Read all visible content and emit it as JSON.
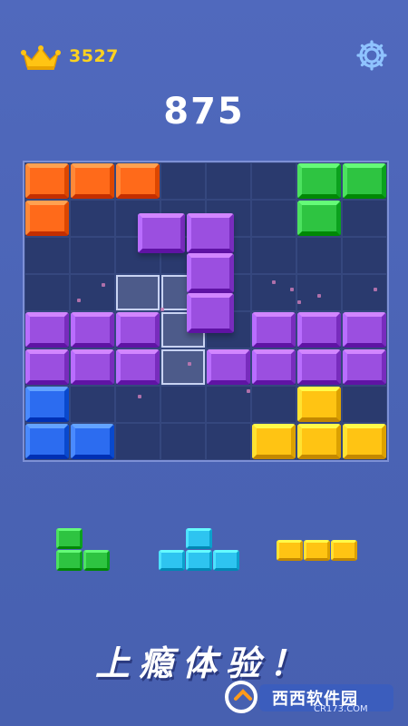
{
  "header": {
    "best_score": "3527",
    "current_score": "875",
    "crown_icon": "crown-icon",
    "settings_icon": "gear-icon"
  },
  "colors": {
    "orange": "#ff6a1a",
    "green": "#2ec441",
    "purple": "#9b4fe0",
    "blue": "#2c6cf0",
    "yellow": "#ffc413",
    "cyan": "#2ec4f0",
    "grid": "#2a3a6e",
    "highlight": "#4d5b8a"
  },
  "board": {
    "cols": 8,
    "rows": 8,
    "placed": [
      {
        "c": 0,
        "r": 0,
        "color": "orange"
      },
      {
        "c": 1,
        "r": 0,
        "color": "orange"
      },
      {
        "c": 2,
        "r": 0,
        "color": "orange"
      },
      {
        "c": 0,
        "r": 1,
        "color": "orange"
      },
      {
        "c": 6,
        "r": 0,
        "color": "green"
      },
      {
        "c": 7,
        "r": 0,
        "color": "green"
      },
      {
        "c": 6,
        "r": 1,
        "color": "green"
      },
      {
        "c": 0,
        "r": 4,
        "color": "purple"
      },
      {
        "c": 1,
        "r": 4,
        "color": "purple"
      },
      {
        "c": 2,
        "r": 4,
        "color": "purple"
      },
      {
        "c": 5,
        "r": 4,
        "color": "purple"
      },
      {
        "c": 6,
        "r": 4,
        "color": "purple"
      },
      {
        "c": 7,
        "r": 4,
        "color": "purple"
      },
      {
        "c": 0,
        "r": 5,
        "color": "purple"
      },
      {
        "c": 1,
        "r": 5,
        "color": "purple"
      },
      {
        "c": 2,
        "r": 5,
        "color": "purple"
      },
      {
        "c": 4,
        "r": 5,
        "color": "purple"
      },
      {
        "c": 5,
        "r": 5,
        "color": "purple"
      },
      {
        "c": 6,
        "r": 5,
        "color": "purple"
      },
      {
        "c": 7,
        "r": 5,
        "color": "purple"
      },
      {
        "c": 0,
        "r": 6,
        "color": "blue"
      },
      {
        "c": 0,
        "r": 7,
        "color": "blue"
      },
      {
        "c": 1,
        "r": 7,
        "color": "blue"
      },
      {
        "c": 6,
        "r": 6,
        "color": "yellow"
      },
      {
        "c": 5,
        "r": 7,
        "color": "yellow"
      },
      {
        "c": 6,
        "r": 7,
        "color": "yellow"
      },
      {
        "c": 7,
        "r": 7,
        "color": "yellow"
      }
    ],
    "ghost": [
      {
        "c": 2,
        "r": 3
      },
      {
        "c": 3,
        "r": 3
      },
      {
        "c": 3,
        "r": 4
      },
      {
        "c": 3,
        "r": 5
      }
    ],
    "dragging_piece": {
      "color": "purple",
      "cells": [
        {
          "c": 0,
          "r": 0
        },
        {
          "c": 1,
          "r": 0
        },
        {
          "c": 1,
          "r": 1
        },
        {
          "c": 1,
          "r": 2
        }
      ]
    }
  },
  "tray": [
    {
      "color": "green",
      "cells": [
        {
          "c": 0,
          "r": 0
        },
        {
          "c": 0,
          "r": 1
        },
        {
          "c": 1,
          "r": 1
        }
      ]
    },
    {
      "color": "cyan",
      "cells": [
        {
          "c": 1,
          "r": 0
        },
        {
          "c": 0,
          "r": 1
        },
        {
          "c": 1,
          "r": 1
        },
        {
          "c": 2,
          "r": 1
        }
      ]
    },
    {
      "color": "yellow",
      "cells": [
        {
          "c": 0,
          "r": 0
        },
        {
          "c": 1,
          "r": 0
        },
        {
          "c": 2,
          "r": 0
        }
      ]
    }
  ],
  "footer": {
    "slogan": "上瘾体验！"
  },
  "watermark": {
    "text": "西西软件园",
    "url": "CR173.COM"
  }
}
